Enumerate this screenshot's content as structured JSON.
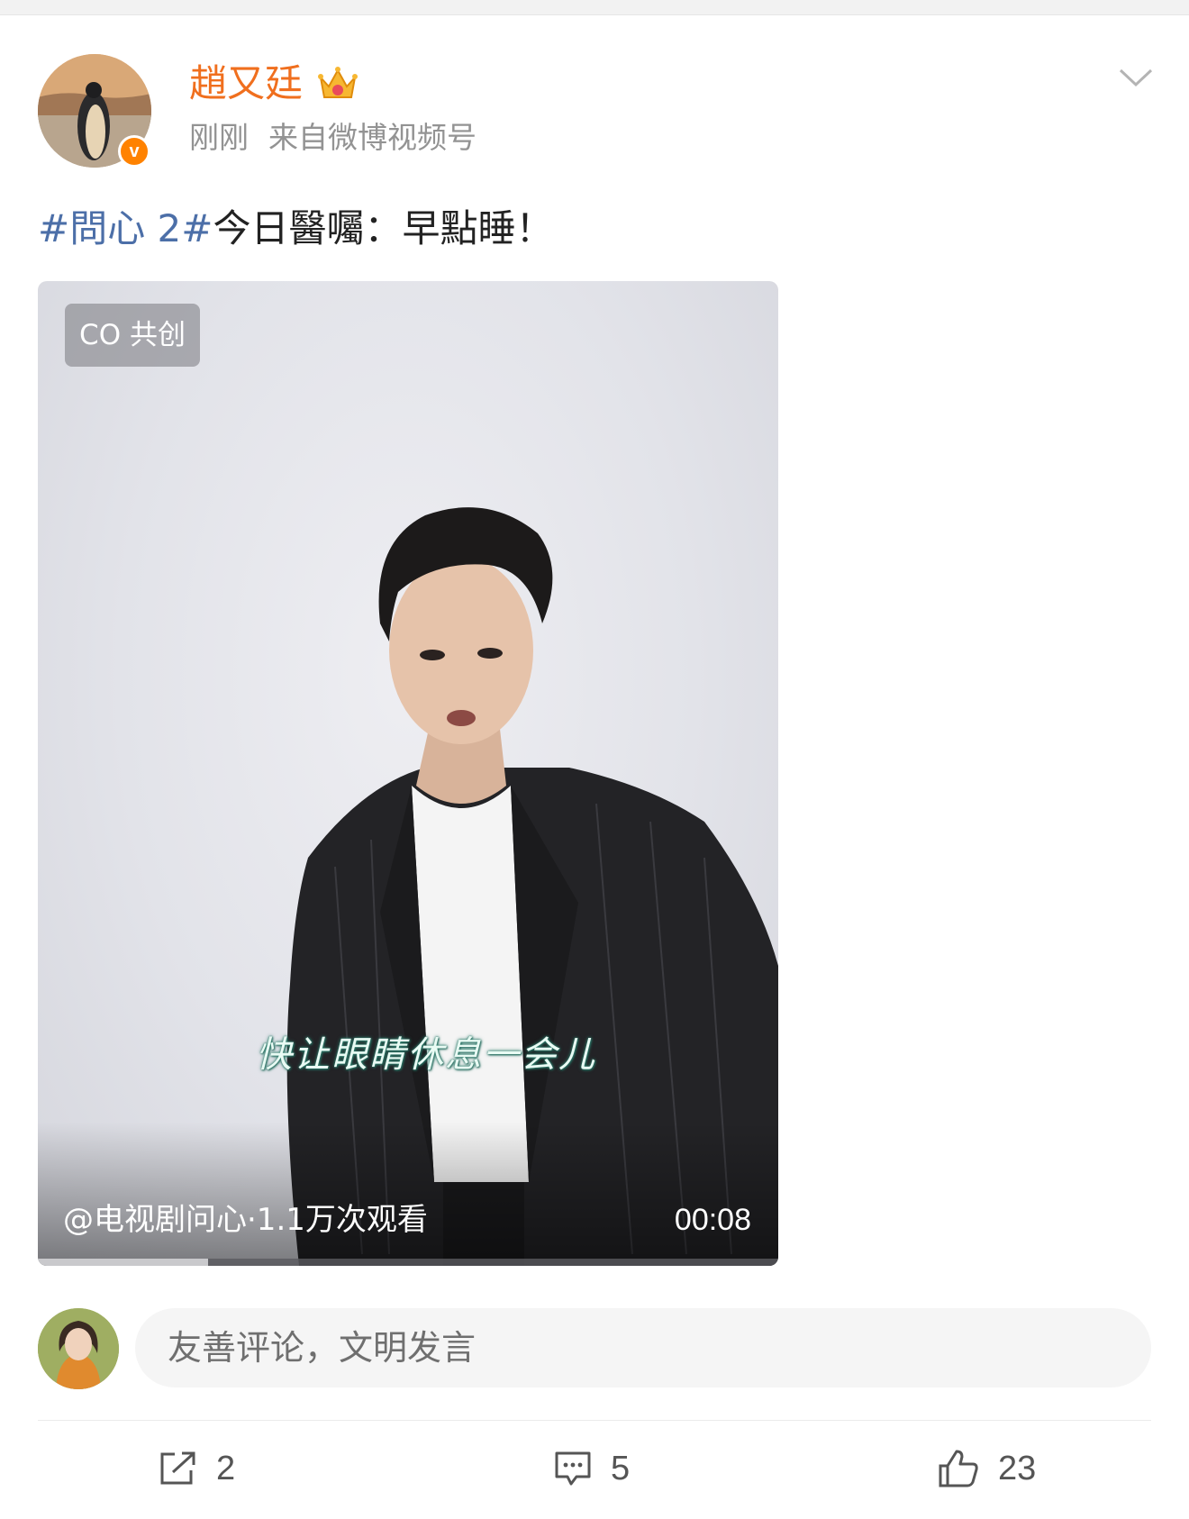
{
  "post": {
    "author": {
      "name": "趙又廷",
      "avatar_icon": "penguin-avatar",
      "badge_icon": "crown-icon",
      "verified_icon": "verified-v-icon",
      "verified_label": "v"
    },
    "meta": {
      "time": "刚刚",
      "source": "来自微博视频号"
    },
    "text": {
      "hashtag": "#問心 2#",
      "body": "今日醫囑：早點睡！"
    },
    "video": {
      "badge": "CO 共创",
      "subtitle": "快让眼睛休息一会儿",
      "source_info": "@电视剧问心·1.1万次观看",
      "duration": "00:08",
      "progress_fraction": 0.23
    }
  },
  "comment_box": {
    "placeholder": "友善评论，文明发言"
  },
  "actions": {
    "repost_count": "2",
    "comment_count": "5",
    "like_count": "23"
  },
  "colors": {
    "username": "#f06f1e",
    "hashtag": "#4c6fa8",
    "verified": "#ff8200",
    "meta": "#939393"
  }
}
